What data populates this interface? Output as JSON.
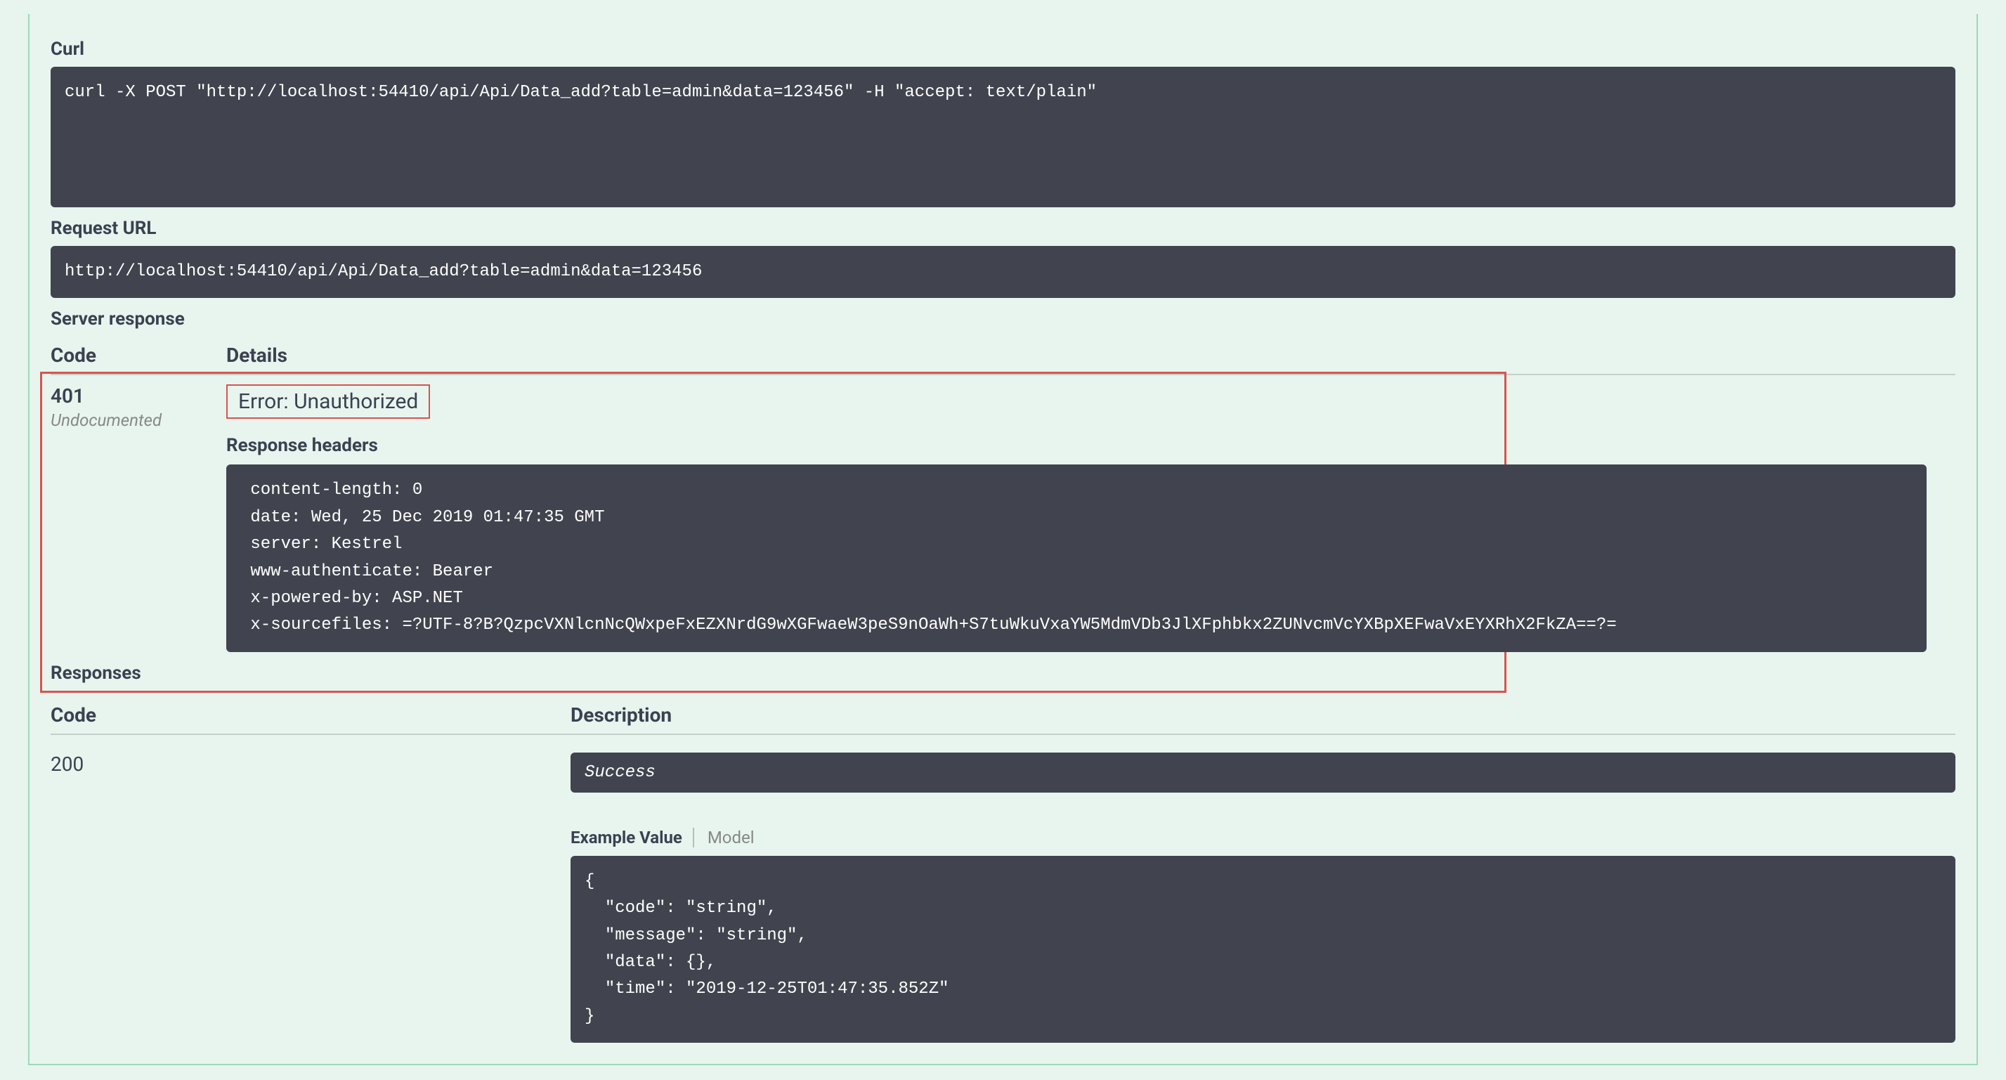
{
  "curl": {
    "label": "Curl",
    "command": "curl -X POST \"http://localhost:54410/api/Api/Data_add?table=admin&data=123456\" -H \"accept: text/plain\""
  },
  "requestUrl": {
    "label": "Request URL",
    "value": "http://localhost:54410/api/Api/Data_add?table=admin&data=123456"
  },
  "serverResponse": {
    "label": "Server response",
    "headerCode": "Code",
    "headerDetails": "Details",
    "code": "401",
    "undocumented": "Undocumented",
    "error": "Error: Unauthorized",
    "responseHeadersLabel": "Response headers",
    "responseHeaders": " content-length: 0\n date: Wed, 25 Dec 2019 01:47:35 GMT\n server: Kestrel\n www-authenticate: Bearer\n x-powered-by: ASP.NET\n x-sourcefiles: =?UTF-8?B?QzpcVXNlcnNcQWxpeFxEZXNrdG9wXGFwaeW3peS9nOaWh+S7tuWkuVxaYW5MdmVDb3JlXFphbkx2ZUNvcmVcYXBpXEFwaVxEYXRhX2FkZA==?="
  },
  "responses": {
    "label": "Responses",
    "headerCode": "Code",
    "headerDescription": "Description",
    "code200": "200",
    "success": "Success",
    "exampleValueTab": "Example Value",
    "modelTab": "Model",
    "exampleBody": "{\n  \"code\": \"string\",\n  \"message\": \"string\",\n  \"data\": {},\n  \"time\": \"2019-12-25T01:47:35.852Z\"\n}"
  }
}
